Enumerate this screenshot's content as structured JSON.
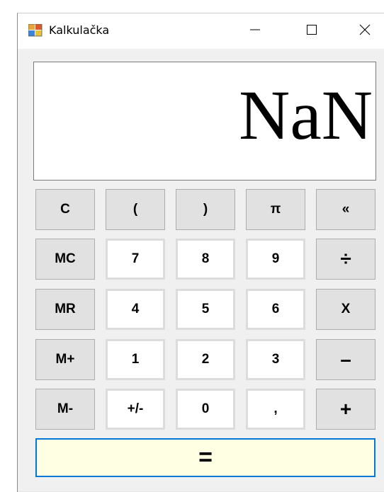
{
  "window": {
    "title": "Kalkulačka",
    "controls": {
      "minimize": "—",
      "maximize": "☐",
      "close": "✕"
    }
  },
  "display": {
    "value": "NaN"
  },
  "keypad": {
    "rows": [
      [
        "C",
        "(",
        ")",
        "π",
        "«"
      ],
      [
        "MC",
        "7",
        "8",
        "9",
        "÷"
      ],
      [
        "MR",
        "4",
        "5",
        "6",
        "X"
      ],
      [
        "M+",
        "1",
        "2",
        "3",
        "–"
      ],
      [
        "M-",
        "+/-",
        "0",
        ",",
        "+"
      ]
    ],
    "equals": "="
  },
  "colors": {
    "equals_background": "#ffffe4",
    "equals_border": "#0078d7"
  },
  "icons": {
    "app": "application-icon"
  }
}
